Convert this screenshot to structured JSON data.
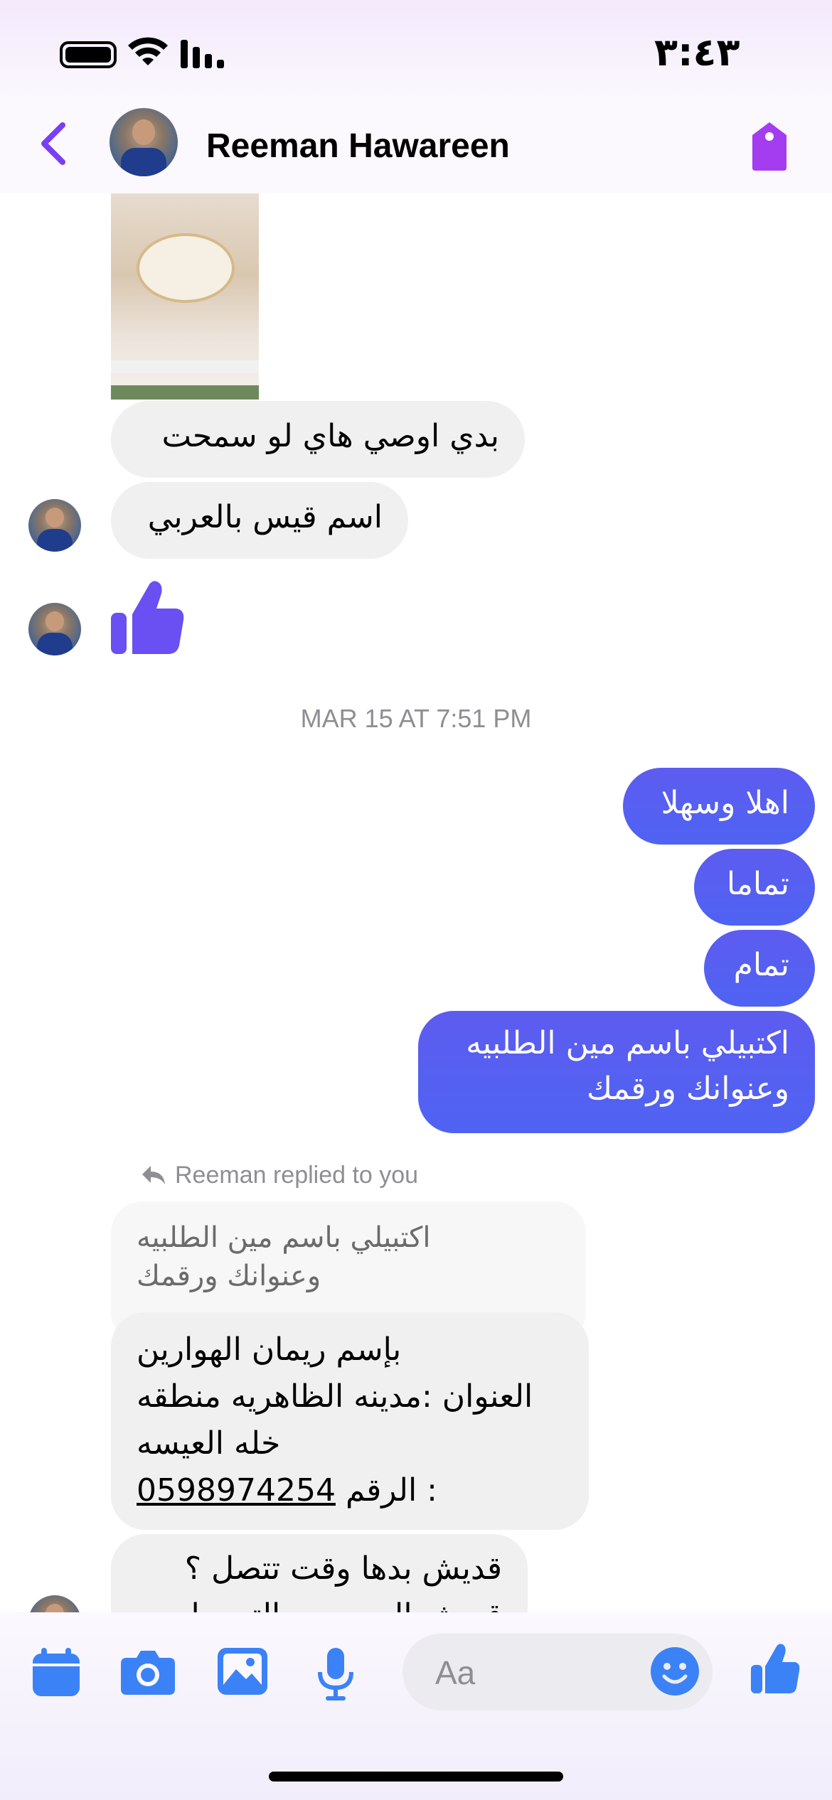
{
  "status_bar": {
    "time": "٣:٤٣"
  },
  "header": {
    "contact_name": "Reeman Hawareen"
  },
  "messages": {
    "in_1": "بدي اوصي هاي لو سمحت",
    "in_2": "اسم قيس بالعربي",
    "timestamp": "MAR 15 AT 7:51 PM",
    "out_1": "اهلا وسهلا",
    "out_2": "تماما",
    "out_3": "تمام",
    "out_4_line1": "اكتبيلي باسم مين الطلبيه",
    "out_4_line2": "وعنوانك ورقمك",
    "replied_label": "Reeman replied to you",
    "quoted_line1": "اكتبيلي باسم مين الطلبيه",
    "quoted_line2": "وعنوانك ورقمك",
    "reply_line1": "بإسم ريمان الهوارين",
    "reply_line2": "العنوان :مدينه الظاهريه منطقه",
    "reply_line3": "خله العيسه",
    "reply_line4_label": "الرقم :",
    "reply_line4_phone": "0598974254",
    "in_3_line1": "قديش بدها وقت تتصل ؟",
    "in_3_line2": "قديش السعر مع التوصيل"
  },
  "composer": {
    "placeholder": "Aa"
  },
  "colors": {
    "accent_purple": "#7b3ff2",
    "outgoing_bubble": "#5b5ef0",
    "incoming_bubble": "#f0f0f0",
    "icon_blue": "#3b82f6"
  },
  "icons": [
    "battery-icon",
    "wifi-icon",
    "signal-icon",
    "back-chevron-icon",
    "tag-icon",
    "thumbs-up-icon",
    "reply-arrow-icon",
    "calendar-icon",
    "camera-icon",
    "gallery-icon",
    "microphone-icon",
    "emoji-icon",
    "like-icon"
  ]
}
